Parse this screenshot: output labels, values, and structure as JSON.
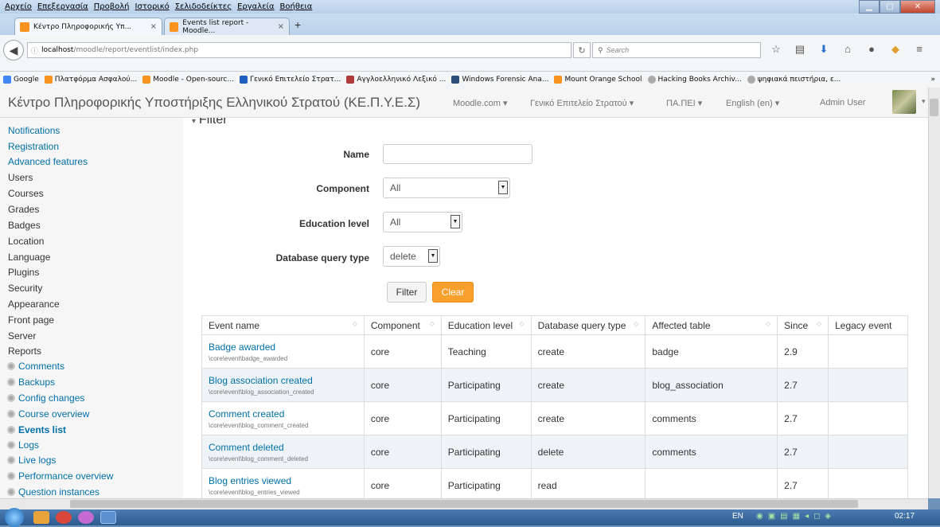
{
  "browser": {
    "menu": [
      "Αρχείο",
      "Επεξεργασία",
      "Προβολή",
      "Ιστορικό",
      "Σελιδοδείκτες",
      "Εργαλεία",
      "Βοήθεια"
    ],
    "tabs": [
      {
        "label": "Κέντρο Πληροφορικής Υπ...",
        "close": "×"
      },
      {
        "label": "Events list report - Moodle...",
        "close": "×"
      }
    ],
    "new_tab": "+",
    "url_host": "localhost",
    "url_path": "/moodle/report/eventlist/index.php",
    "search_placeholder": "Search",
    "bookmarks": [
      "Google",
      "Πλατφόρμα Ασφαλού...",
      "Moodle - Open-sourc...",
      "Γενικό Επιτελείο Στρατ...",
      "Αγγλοελληνικό Λεξικό ...",
      "Windows Forensic Ana...",
      "Mount Orange School",
      "Hacking Books Archiv...",
      "ψηφιακά πειστήρια, ε..."
    ],
    "bookmarks_more": "»"
  },
  "moodle": {
    "site_name": "Κέντρο Πληροφορικής Υποστήριξης Ελληνικού Στρατού (ΚΕ.Π.Υ.Ε.Σ)",
    "nav": [
      "Moodle.com ▾",
      "Γενικό Επιτελείο Στρατού ▾",
      "ΠΑ.ΠΕΙ ▾",
      "English (en) ▾"
    ],
    "user": "Admin User",
    "user_menu_arrow": "▾"
  },
  "sidebar": {
    "items": [
      {
        "label": "Notifications",
        "kind": "link"
      },
      {
        "label": "Registration",
        "kind": "link"
      },
      {
        "label": "Advanced features",
        "kind": "link"
      },
      {
        "label": "Users",
        "kind": "text"
      },
      {
        "label": "Courses",
        "kind": "text"
      },
      {
        "label": "Grades",
        "kind": "text"
      },
      {
        "label": "Badges",
        "kind": "text"
      },
      {
        "label": "Location",
        "kind": "text"
      },
      {
        "label": "Language",
        "kind": "text"
      },
      {
        "label": "Plugins",
        "kind": "text"
      },
      {
        "label": "Security",
        "kind": "text"
      },
      {
        "label": "Appearance",
        "kind": "text"
      },
      {
        "label": "Front page",
        "kind": "text"
      },
      {
        "label": "Server",
        "kind": "text"
      },
      {
        "label": "Reports",
        "kind": "text"
      },
      {
        "label": "Comments",
        "kind": "cog"
      },
      {
        "label": "Backups",
        "kind": "cog"
      },
      {
        "label": "Config changes",
        "kind": "cog"
      },
      {
        "label": "Course overview",
        "kind": "cog"
      },
      {
        "label": "Events list",
        "kind": "cog-active"
      },
      {
        "label": "Logs",
        "kind": "cog"
      },
      {
        "label": "Live logs",
        "kind": "cog"
      },
      {
        "label": "Performance overview",
        "kind": "cog"
      },
      {
        "label": "Question instances",
        "kind": "cog"
      }
    ]
  },
  "filter": {
    "legend": "Filter",
    "name_label": "Name",
    "name_value": "",
    "component_label": "Component",
    "component_value": "All",
    "edu_label": "Education level",
    "edu_value": "All",
    "dbq_label": "Database query type",
    "dbq_value": "delete",
    "filter_button": "Filter",
    "clear_button": "Clear"
  },
  "table": {
    "headers": [
      "Event name",
      "Component",
      "Education level",
      "Database query type",
      "Affected table",
      "Since",
      "Legacy event"
    ],
    "rows": [
      {
        "name": "Badge awarded",
        "path": "\\core\\event\\badge_awarded",
        "component": "core",
        "edu": "Teaching",
        "dbq": "create",
        "affected": "badge",
        "since": "2.9",
        "legacy": ""
      },
      {
        "name": "Blog association created",
        "path": "\\core\\event\\blog_association_created",
        "component": "core",
        "edu": "Participating",
        "dbq": "create",
        "affected": "blog_association",
        "since": "2.7",
        "legacy": ""
      },
      {
        "name": "Comment created",
        "path": "\\core\\event\\blog_comment_created",
        "component": "core",
        "edu": "Participating",
        "dbq": "create",
        "affected": "comments",
        "since": "2.7",
        "legacy": ""
      },
      {
        "name": "Comment deleted",
        "path": "\\core\\event\\blog_comment_deleted",
        "component": "core",
        "edu": "Participating",
        "dbq": "delete",
        "affected": "comments",
        "since": "2.7",
        "legacy": ""
      },
      {
        "name": "Blog entries viewed",
        "path": "\\core\\event\\blog_entries_viewed",
        "component": "core",
        "edu": "Participating",
        "dbq": "read",
        "affected": "",
        "since": "2.7",
        "legacy": ""
      }
    ]
  },
  "taskbar": {
    "lang": "EN",
    "clock": "02:17"
  }
}
